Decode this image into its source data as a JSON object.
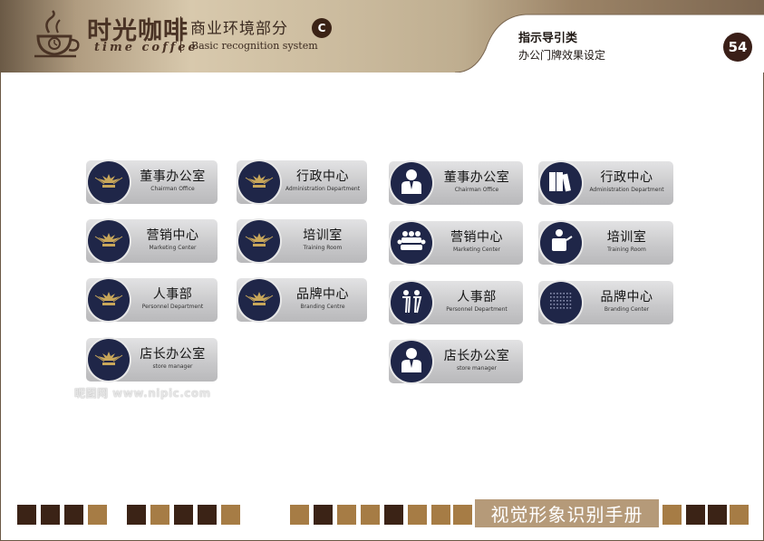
{
  "header": {
    "brand_cn": "时光咖啡",
    "brand_en": "time coffee",
    "section_cn": "商业环境部分",
    "section_badge": "C",
    "section_en": "Basic recognition system",
    "tab_title": "指示导引类",
    "tab_subtitle": "办公门牌效果设定",
    "page_number": "54"
  },
  "plates": [
    {
      "cn": "董事办公室",
      "en": "Chairman Office",
      "icon": "ornament-icon"
    },
    {
      "cn": "行政中心",
      "en": "Administration Department",
      "icon": "ornament-icon"
    },
    {
      "cn": "董事办公室",
      "en": "Chairman Office",
      "icon": "executive-person-icon"
    },
    {
      "cn": "行政中心",
      "en": "Administration Department",
      "icon": "binders-icon"
    },
    {
      "cn": "营销中心",
      "en": "Marketing Center",
      "icon": "ornament-icon"
    },
    {
      "cn": "培训室",
      "en": "Training Room",
      "icon": "ornament-icon"
    },
    {
      "cn": "营销中心",
      "en": "Marketing Center",
      "icon": "meeting-group-icon"
    },
    {
      "cn": "培训室",
      "en": "Training Room",
      "icon": "presenter-icon"
    },
    {
      "cn": "人事部",
      "en": "Personnel Department",
      "icon": "ornament-icon"
    },
    {
      "cn": "品牌中心",
      "en": "Branding Centre",
      "icon": "ornament-icon"
    },
    {
      "cn": "人事部",
      "en": "Personnel Department",
      "icon": "two-people-icon"
    },
    {
      "cn": "品牌中心",
      "en": "Branding Center",
      "icon": "dot-grid-icon"
    },
    {
      "cn": "店长办公室",
      "en": "store manager",
      "icon": "ornament-icon"
    },
    {
      "cn": "店长办公室",
      "en": "store manager",
      "icon": "executive-person-icon"
    }
  ],
  "watermark": "昵图网 www.nipic.com",
  "footer": {
    "title": "视觉形象识别手册"
  },
  "colors": {
    "dark_brown": "#3b2316",
    "gold_brown": "#a67c45",
    "navy": "#1f2648",
    "plate_silver": "#c9c9cb"
  }
}
